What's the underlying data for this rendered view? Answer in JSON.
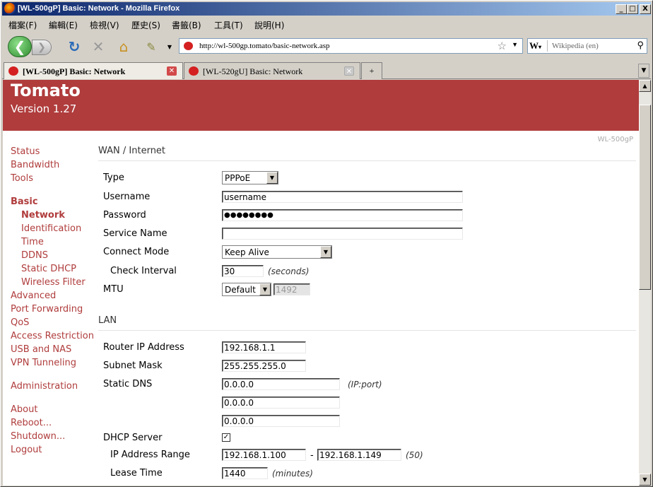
{
  "window": {
    "title": "[WL-500gP] Basic: Network - Mozilla Firefox",
    "controls": [
      "_",
      "□",
      "X"
    ]
  },
  "menu": [
    "檔案(F)",
    "編輯(E)",
    "檢視(V)",
    "歷史(S)",
    "書籤(B)",
    "工具(T)",
    "說明(H)"
  ],
  "nav": {
    "url": "http://wl-500gp.tomato/basic-network.asp",
    "search_engine": "W",
    "search_placeholder": "Wikipedia (en)"
  },
  "tabs": [
    {
      "title": "[WL-500gP] Basic: Network",
      "active": true
    },
    {
      "title": "[WL-520gU] Basic: Network",
      "active": false
    }
  ],
  "banner": {
    "title": "Tomato",
    "version": "Version 1.27",
    "model": "WL-500gP"
  },
  "sidebar": {
    "items": [
      "Status",
      "Bandwidth",
      "Tools",
      "Basic",
      "Network",
      "Identification",
      "Time",
      "DDNS",
      "Static DHCP",
      "Wireless Filter",
      "Advanced",
      "Port Forwarding",
      "QoS",
      "Access Restriction",
      "USB and NAS",
      "VPN Tunneling",
      "Administration",
      "About",
      "Reboot...",
      "Shutdown...",
      "Logout"
    ]
  },
  "wan": {
    "header": "WAN / Internet",
    "type_label": "Type",
    "type_value": "PPPoE",
    "username_label": "Username",
    "username_value": "username",
    "password_label": "Password",
    "password_value": "●●●●●●●●",
    "service_label": "Service Name",
    "service_value": "",
    "connect_label": "Connect Mode",
    "connect_value": "Keep Alive",
    "check_label": "Check Interval",
    "check_value": "30",
    "check_note": "(seconds)",
    "mtu_label": "MTU",
    "mtu_mode": "Default",
    "mtu_value": "1492"
  },
  "lan": {
    "header": "LAN",
    "router_ip_label": "Router IP Address",
    "router_ip_value": "192.168.1.1",
    "subnet_label": "Subnet Mask",
    "subnet_value": "255.255.255.0",
    "dns_label": "Static DNS",
    "dns_values": [
      "0.0.0.0",
      "0.0.0.0",
      "0.0.0.0"
    ],
    "dns_note": "(IP:port)",
    "dhcp_label": "DHCP Server",
    "dhcp_checked": "✓",
    "range_label": "IP Address Range",
    "range_start": "192.168.1.100",
    "range_sep": "-",
    "range_end": "192.168.1.149",
    "range_count": "(50)",
    "lease_label": "Lease Time",
    "lease_value": "1440",
    "lease_note": "(minutes)"
  },
  "colors": {
    "brand": "#b03c3c",
    "chrome": "#d4d0c8"
  }
}
